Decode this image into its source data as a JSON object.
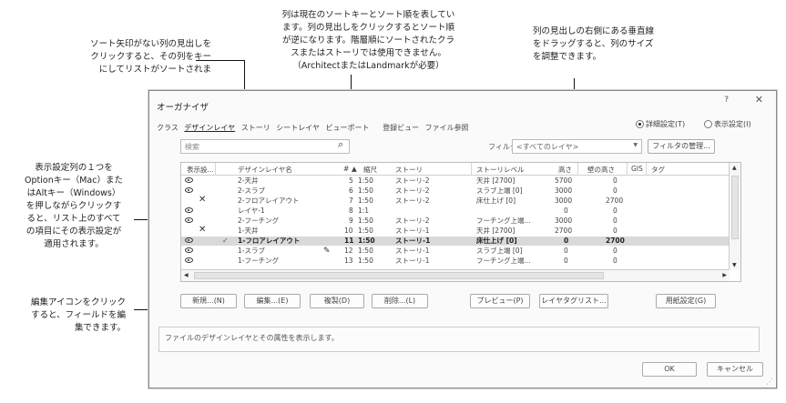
{
  "callouts": {
    "no_sort_arrow": "ソート矢印がない列の見出しを\nクリックすると、その列をキー\nにしてリストがソートされま",
    "sort_key": "列は現在のソートキーとソート順を表してい\nます。列の見出しをクリックするとソート順\nが逆になります。階層順にソートされたクラ\nスまたはストーリでは使用できません。\n（ArchitectまたはLandmarkが必要）",
    "resize": "列の見出しの右側にある垂直線\nをドラッグすると、列のサイズ\nを調整できます。",
    "visibility": "表示設定列の１つを\nOptionキー（Mac）また\nはAltキー（Windows）\nを押しながらクリックす\nると、リスト上のすべて\nの項目にその表示設定が\n適用されます。",
    "edit": "編集アイコンをクリック\nすると、フィールドを編\n集できます。"
  },
  "dialog": {
    "title": "オーガナイザ",
    "help": "?",
    "close": "✕",
    "tabs": [
      "クラス",
      "デザインレイヤ",
      "ストーリ",
      "シートレイヤ",
      "ビューポート",
      "登録ビュー",
      "ファイル参照"
    ],
    "radio_detailed": "詳細設定(T)",
    "radio_visibility": "表示設定(I)",
    "search_placeholder": "検索",
    "filter_label": "フィルタ:",
    "filter_value": "<すべてのレイヤ>",
    "filter_manage": "フィルタの管理...",
    "columns": [
      "表示設...",
      "デザインレイヤ名",
      "#",
      "▲",
      "縮尺",
      "ストーリ",
      "ストーリレベル",
      "高さ",
      "壁の高さ",
      "GIS",
      "タグ"
    ],
    "rows": [
      {
        "name": "2-天井",
        "num": "5",
        "scale": "1:50",
        "story": "ストーリ-2",
        "level": "天井 [2700]",
        "height": "5700",
        "wall": "0"
      },
      {
        "name": "2-スラブ",
        "num": "6",
        "scale": "1:50",
        "story": "ストーリ-2",
        "level": "スラブ上端 [0]",
        "height": "3000",
        "wall": "0"
      },
      {
        "name": "2-フロアレイアウト",
        "num": "7",
        "scale": "1:50",
        "story": "ストーリ-2",
        "level": "床仕上げ [0]",
        "height": "3000",
        "wall": "2700"
      },
      {
        "name": "レイヤ-1",
        "num": "8",
        "scale": "1:1",
        "story": "",
        "level": "",
        "height": "0",
        "wall": "0"
      },
      {
        "name": "2-フーチング",
        "num": "9",
        "scale": "1:50",
        "story": "ストーリ-2",
        "level": "フーチング上端...",
        "height": "3000",
        "wall": "0"
      },
      {
        "name": "1-天井",
        "num": "10",
        "scale": "1:50",
        "story": "ストーリ-1",
        "level": "天井 [2700]",
        "height": "2700",
        "wall": "0"
      },
      {
        "name": "1-フロアレイアウト",
        "num": "11",
        "scale": "1:50",
        "story": "ストーリ-1",
        "level": "床仕上げ [0]",
        "height": "0",
        "wall": "2700"
      },
      {
        "name": "1-スラブ",
        "num": "12",
        "scale": "1:50",
        "story": "ストーリ-1",
        "level": "スラブ上端 [0]",
        "height": "0",
        "wall": "0"
      },
      {
        "name": "1-フーチング",
        "num": "13",
        "scale": "1:50",
        "story": "ストーリ-1",
        "level": "フーチング上端...",
        "height": "0",
        "wall": "0"
      }
    ],
    "buttons": {
      "new": "新規...(N)",
      "edit": "編集...(E)",
      "duplicate": "複製(D)",
      "delete": "削除...(L)",
      "preview": "プレビュー(P)",
      "layer_list": "レイヤタグリスト...",
      "scale_settings": "用紙設定(G)",
      "ok": "OK",
      "cancel": "キャンセル"
    },
    "description": "ファイルのデザインレイヤとその属性を表示します。"
  }
}
